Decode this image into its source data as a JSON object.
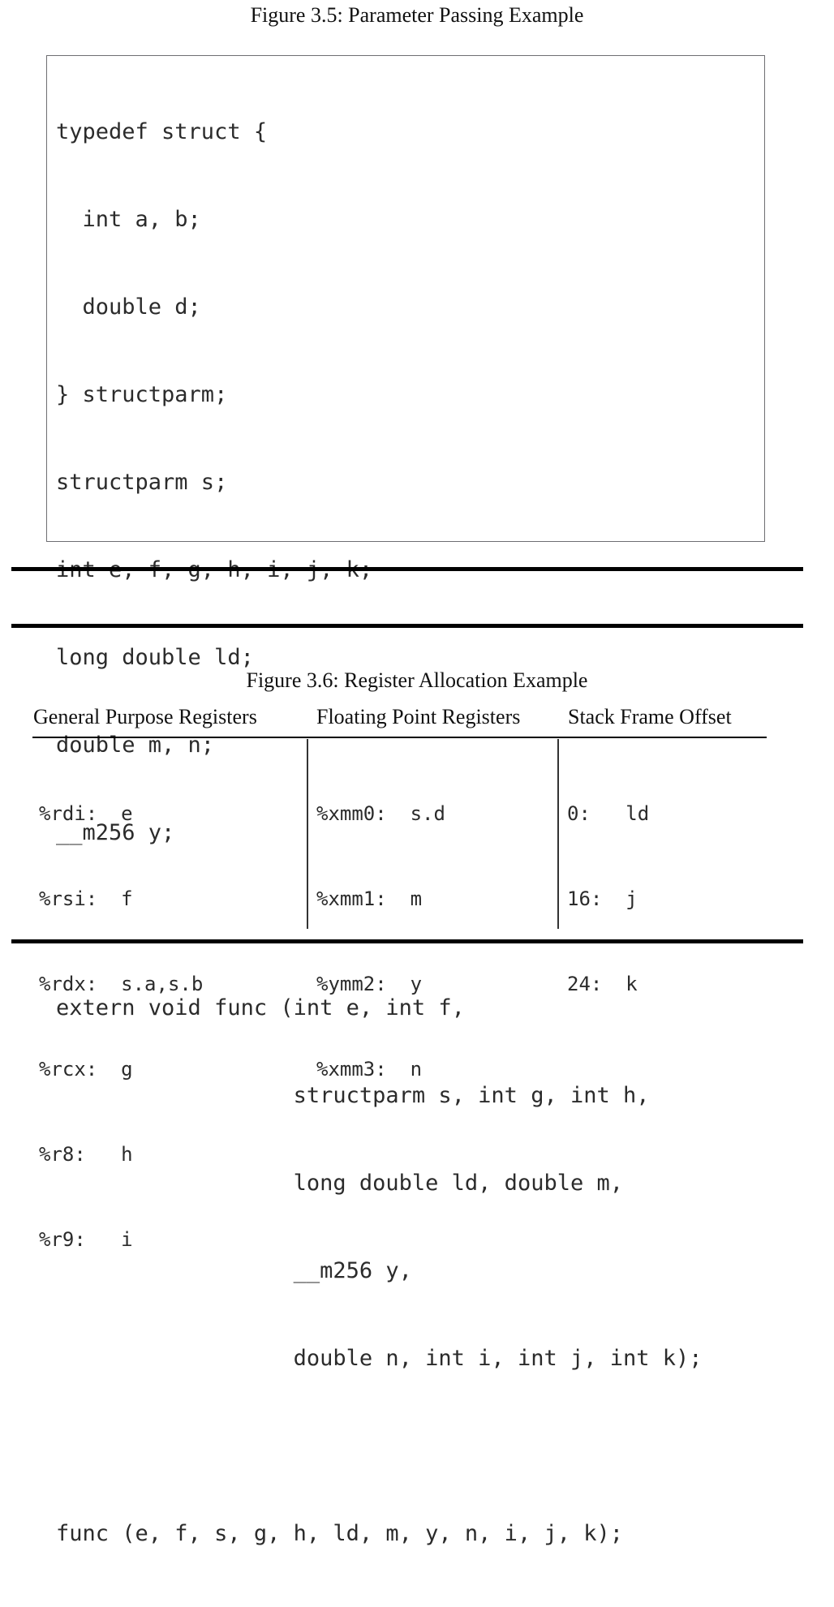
{
  "figure_35": {
    "caption": "Figure 3.5: Parameter Passing Example",
    "code_lines": [
      "typedef struct {",
      "  int a, b;",
      "  double d;",
      "} structparm;",
      "structparm s;",
      "int e, f, g, h, i, j, k;",
      "long double ld;",
      "double m, n;",
      "__m256 y;",
      "",
      "extern void func (int e, int f,",
      "                  structparm s, int g, int h,",
      "                  long double ld, double m,",
      "                  __m256 y,",
      "                  double n, int i, int j, int k);",
      "",
      "func (e, f, s, g, h, ld, m, y, n, i, j, k);"
    ]
  },
  "figure_36": {
    "caption": "Figure 3.6: Register Allocation Example",
    "columns": [
      {
        "header": "General Purpose Registers",
        "rows": [
          "%rdi:  e",
          "%rsi:  f",
          "%rdx:  s.a,s.b",
          "%rcx:  g",
          "%r8:   h",
          "%r9:   i"
        ]
      },
      {
        "header": "Floating Point Registers",
        "rows": [
          "%xmm0:  s.d",
          "%xmm1:  m",
          "%ymm2:  y",
          "%xmm3:  n"
        ]
      },
      {
        "header": "Stack Frame Offset",
        "rows": [
          "0:   ld",
          "16:  j",
          "24:  k"
        ]
      }
    ]
  },
  "colors": {
    "rule": "#000000",
    "code_border": "#6e6e72",
    "text": "#111111",
    "code_text": "#2b2b2b"
  }
}
